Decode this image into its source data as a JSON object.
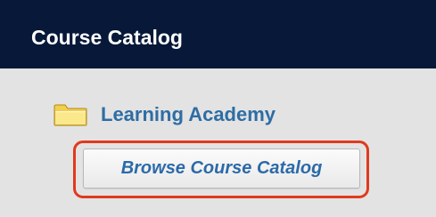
{
  "panel": {
    "title": "Course Catalog"
  },
  "tree": {
    "item_label": "Learning Academy",
    "item_icon": "folder-icon"
  },
  "actions": {
    "browse_label": "Browse Course Catalog"
  },
  "colors": {
    "header_bg": "#071838",
    "body_bg": "#e3e3e3",
    "link_blue": "#2e6da4",
    "highlight_red": "#e03a1e",
    "folder_yellow": "#f7dc6f"
  }
}
